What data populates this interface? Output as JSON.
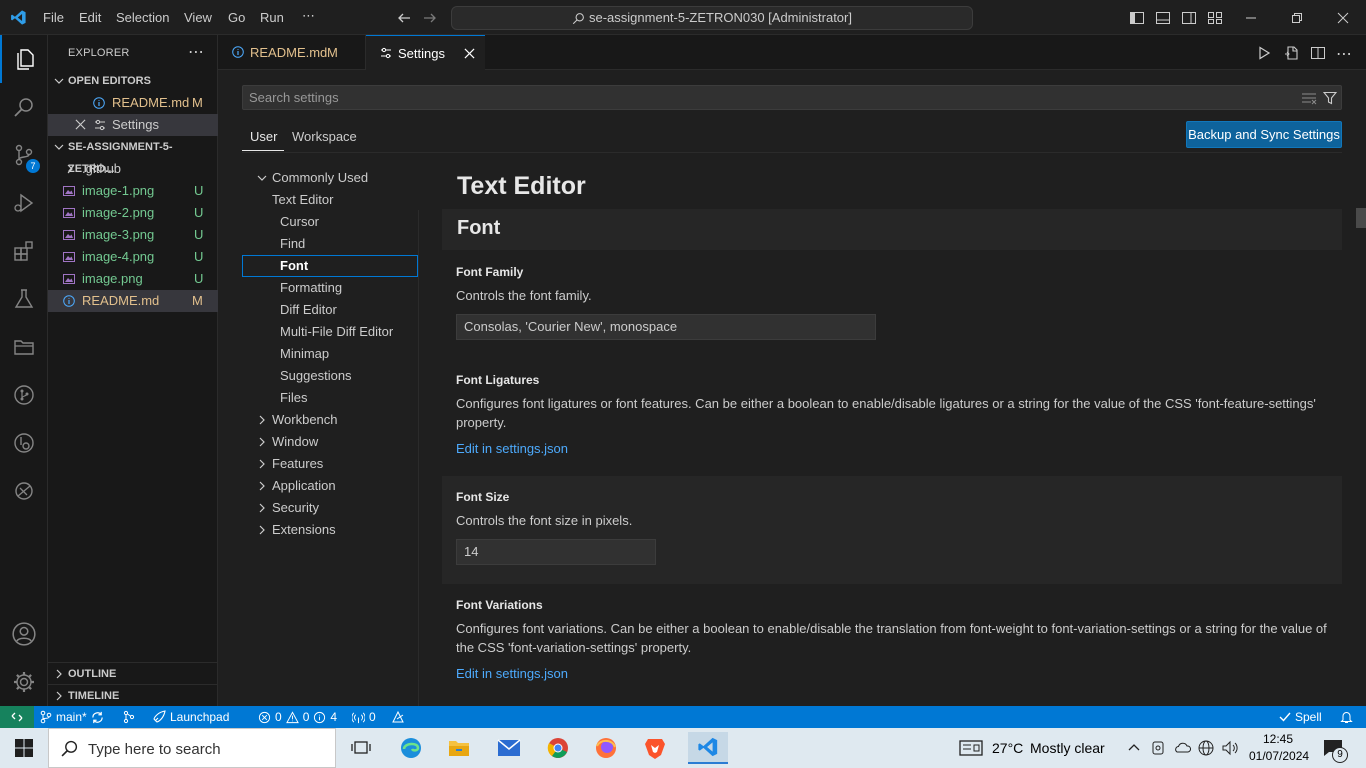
{
  "menu": [
    "File",
    "Edit",
    "Selection",
    "View",
    "Go",
    "Run",
    "⋯"
  ],
  "command_center": "se-assignment-5-ZETRON030 [Administrator]",
  "activity": {
    "scm_badge": "7"
  },
  "sidebar": {
    "title": "EXPLORER",
    "more": "⋯",
    "open_editors_label": "OPEN EDITORS",
    "open_editors": [
      {
        "name": "README.md",
        "status": "M"
      },
      {
        "name": "Settings",
        "status": ""
      }
    ],
    "folder_label": "SE-ASSIGNMENT-5-ZETRO...",
    "files": [
      {
        "name": ".github",
        "status": ""
      },
      {
        "name": "image-1.png",
        "status": "U"
      },
      {
        "name": "image-2.png",
        "status": "U"
      },
      {
        "name": "image-3.png",
        "status": "U"
      },
      {
        "name": "image-4.png",
        "status": "U"
      },
      {
        "name": "image.png",
        "status": "U"
      },
      {
        "name": "README.md",
        "status": "M"
      }
    ],
    "outline_label": "OUTLINE",
    "timeline_label": "TIMELINE"
  },
  "tabs": [
    {
      "label": "README.md",
      "status": "M"
    },
    {
      "label": "Settings"
    }
  ],
  "settings": {
    "search_placeholder": "Search settings",
    "scope_tabs": [
      "User",
      "Workspace"
    ],
    "backup_button": "Backup and Sync Settings",
    "toc": [
      "Commonly Used",
      "Text Editor",
      "Cursor",
      "Find",
      "Font",
      "Formatting",
      "Diff Editor",
      "Multi-File Diff Editor",
      "Minimap",
      "Suggestions",
      "Files",
      "Workbench",
      "Window",
      "Features",
      "Application",
      "Security",
      "Extensions"
    ],
    "section_title": "Text Editor",
    "group_title": "Font",
    "items": [
      {
        "title": "Font Family",
        "desc": "Controls the font family.",
        "value": "Consolas, 'Courier New', monospace"
      },
      {
        "title": "Font Ligatures",
        "desc": "Configures font ligatures or font features. Can be either a boolean to enable/disable ligatures or a string for the value of the CSS 'font-feature-settings' property.",
        "link": "Edit in settings.json"
      },
      {
        "title": "Font Size",
        "desc": "Controls the font size in pixels.",
        "value": "14"
      },
      {
        "title": "Font Variations",
        "desc": "Configures font variations. Can be either a boolean to enable/disable the translation from font-weight to font-variation-settings or a string for the value of the CSS 'font-variation-settings' property.",
        "link": "Edit in settings.json"
      }
    ]
  },
  "statusbar": {
    "branch": "main*",
    "launchpad": "Launchpad",
    "errors": "0",
    "warnings": "0",
    "infos": "4",
    "ports": "0",
    "spell": "Spell"
  },
  "taskbar": {
    "search_placeholder": "Type here to search",
    "weather_temp": "27°C",
    "weather_desc": "Mostly clear",
    "time": "12:45",
    "date": "01/07/2024",
    "notifications": "9"
  },
  "colors": {
    "accent": "#0078d4",
    "untracked": "#73c991",
    "modified": "#e2c08d",
    "link": "#4daafc"
  }
}
